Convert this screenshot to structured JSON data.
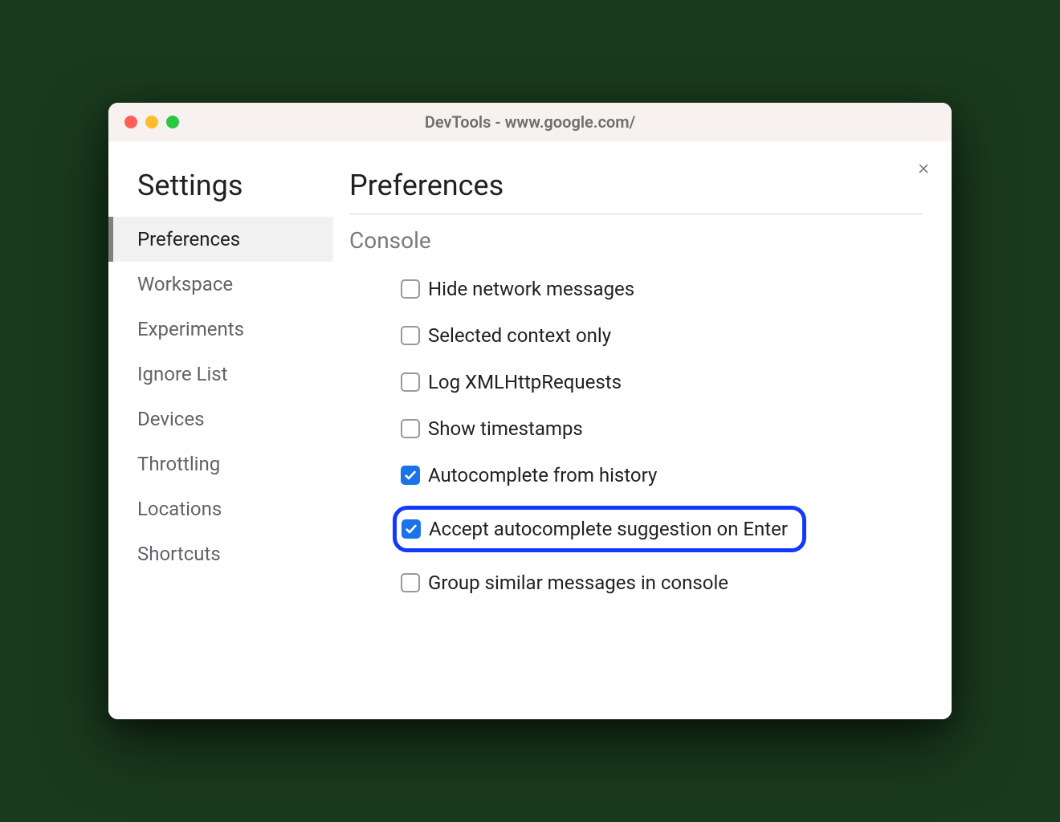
{
  "window": {
    "title": "DevTools - www.google.com/"
  },
  "close_label": "×",
  "sidebar": {
    "title": "Settings",
    "items": [
      {
        "label": "Preferences",
        "active": true
      },
      {
        "label": "Workspace",
        "active": false
      },
      {
        "label": "Experiments",
        "active": false
      },
      {
        "label": "Ignore List",
        "active": false
      },
      {
        "label": "Devices",
        "active": false
      },
      {
        "label": "Throttling",
        "active": false
      },
      {
        "label": "Locations",
        "active": false
      },
      {
        "label": "Shortcuts",
        "active": false
      }
    ]
  },
  "main": {
    "title": "Preferences",
    "section": "Console",
    "options": [
      {
        "label": "Hide network messages",
        "checked": false,
        "highlighted": false
      },
      {
        "label": "Selected context only",
        "checked": false,
        "highlighted": false
      },
      {
        "label": "Log XMLHttpRequests",
        "checked": false,
        "highlighted": false
      },
      {
        "label": "Show timestamps",
        "checked": false,
        "highlighted": false
      },
      {
        "label": "Autocomplete from history",
        "checked": true,
        "highlighted": false
      },
      {
        "label": "Accept autocomplete suggestion on Enter",
        "checked": true,
        "highlighted": true
      },
      {
        "label": "Group similar messages in console",
        "checked": false,
        "highlighted": false
      }
    ]
  }
}
